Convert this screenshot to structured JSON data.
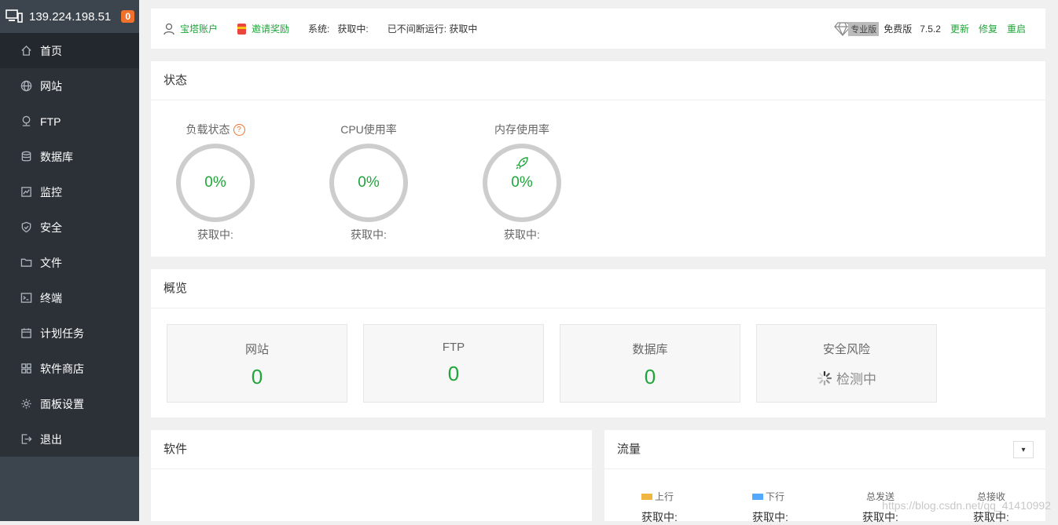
{
  "sidebar": {
    "ip": "139.224.198.51",
    "badge": "0",
    "items": [
      {
        "label": "首页",
        "icon": "home-icon"
      },
      {
        "label": "网站",
        "icon": "globe-icon"
      },
      {
        "label": "FTP",
        "icon": "ftp-icon"
      },
      {
        "label": "数据库",
        "icon": "database-icon"
      },
      {
        "label": "监控",
        "icon": "monitor-icon"
      },
      {
        "label": "安全",
        "icon": "shield-icon"
      },
      {
        "label": "文件",
        "icon": "folder-icon"
      },
      {
        "label": "终端",
        "icon": "terminal-icon"
      },
      {
        "label": "计划任务",
        "icon": "calendar-icon"
      },
      {
        "label": "软件商店",
        "icon": "grid-icon"
      },
      {
        "label": "面板设置",
        "icon": "gear-icon"
      },
      {
        "label": "退出",
        "icon": "logout-icon"
      }
    ]
  },
  "topbar": {
    "account": "宝塔账户",
    "invite": "邀请奖励",
    "system_label": "系统:",
    "system_value": "获取中:",
    "uptime": "已不间断运行: 获取中",
    "pro_tag": "专业版",
    "edition": "免费版",
    "version": "7.5.2",
    "update": "更新",
    "repair": "修复",
    "restart": "重启"
  },
  "status": {
    "title": "状态",
    "gauges": [
      {
        "label": "负载状态",
        "value": "0%",
        "sub": "获取中:"
      },
      {
        "label": "CPU使用率",
        "value": "0%",
        "sub": "获取中:"
      },
      {
        "label": "内存使用率",
        "value": "0%",
        "sub": "获取中:"
      }
    ]
  },
  "overview": {
    "title": "概览",
    "cards": [
      {
        "label": "网站",
        "value": "0"
      },
      {
        "label": "FTP",
        "value": "0"
      },
      {
        "label": "数据库",
        "value": "0"
      },
      {
        "label": "安全风险",
        "value": "检测中"
      }
    ]
  },
  "software": {
    "title": "软件"
  },
  "traffic": {
    "title": "流量",
    "select_symbol": "▾",
    "columns": [
      {
        "label": "上行",
        "value": "获取中:",
        "color": "#f1b541"
      },
      {
        "label": "下行",
        "value": "获取中:",
        "color": "#52a9ff"
      },
      {
        "label": "总发送",
        "value": "获取中:"
      },
      {
        "label": "总接收",
        "value": "获取中:"
      }
    ]
  },
  "watermark": "https://blog.csdn.net/qq_41410992"
}
